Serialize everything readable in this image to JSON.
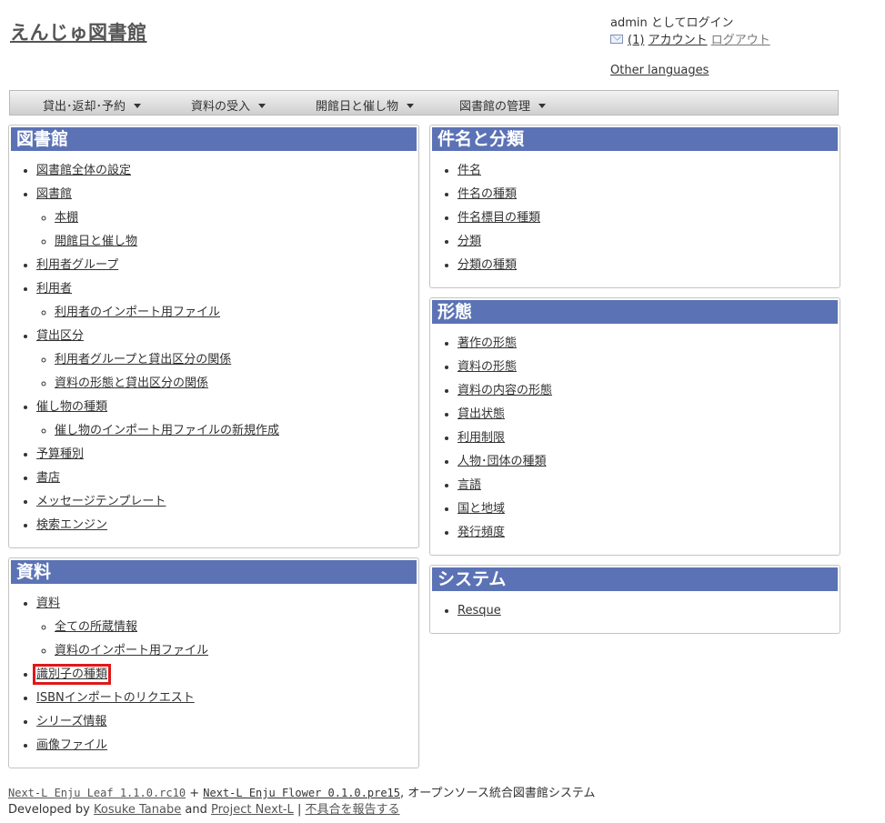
{
  "site": {
    "title": "えんじゅ図書館"
  },
  "user": {
    "login_text": "admin としてログイン",
    "message_count": "(1)",
    "account": "アカウント",
    "logout": "ログアウト",
    "other_languages": "Other languages",
    "mail_icon": "mail-icon"
  },
  "nav": [
    {
      "label": "貸出･返却･予約"
    },
    {
      "label": "資料の受入"
    },
    {
      "label": "開館日と催し物"
    },
    {
      "label": "図書館の管理"
    }
  ],
  "panels": {
    "library": {
      "title": "図書館",
      "items": [
        {
          "label": "図書館全体の設定"
        },
        {
          "label": "図書館",
          "children": [
            {
              "label": "本棚"
            },
            {
              "label": "開館日と催し物"
            }
          ]
        },
        {
          "label": "利用者グループ"
        },
        {
          "label": "利用者",
          "children": [
            {
              "label": "利用者のインポート用ファイル"
            }
          ]
        },
        {
          "label": "貸出区分",
          "children": [
            {
              "label": "利用者グループと貸出区分の関係"
            },
            {
              "label": "資料の形態と貸出区分の関係"
            }
          ]
        },
        {
          "label": "催し物の種類",
          "children": [
            {
              "label": "催し物のインポート用ファイルの新規作成"
            }
          ]
        },
        {
          "label": "予算種別"
        },
        {
          "label": "書店"
        },
        {
          "label": "メッセージテンプレート"
        },
        {
          "label": "検索エンジン"
        }
      ]
    },
    "materials": {
      "title": "資料",
      "items": [
        {
          "label": "資料",
          "children": [
            {
              "label": "全ての所蔵情報"
            },
            {
              "label": "資料のインポート用ファイル"
            }
          ]
        },
        {
          "label": "識別子の種類",
          "highlighted": true
        },
        {
          "label": "ISBNインポートのリクエスト"
        },
        {
          "label": "シリーズ情報"
        },
        {
          "label": "画像ファイル"
        }
      ]
    },
    "subjects": {
      "title": "件名と分類",
      "items": [
        {
          "label": "件名"
        },
        {
          "label": "件名の種類"
        },
        {
          "label": "件名標目の種類"
        },
        {
          "label": "分類"
        },
        {
          "label": "分類の種類"
        }
      ]
    },
    "forms": {
      "title": "形態",
      "items": [
        {
          "label": "著作の形態"
        },
        {
          "label": "資料の形態"
        },
        {
          "label": "資料の内容の形態"
        },
        {
          "label": "貸出状態"
        },
        {
          "label": "利用制限"
        },
        {
          "label": "人物･団体の種類"
        },
        {
          "label": "言語"
        },
        {
          "label": "国と地域"
        },
        {
          "label": "発行頻度"
        }
      ]
    },
    "system": {
      "title": "システム",
      "items": [
        {
          "label": "Resque"
        }
      ]
    }
  },
  "footer": {
    "leaf": "Next-L Enju Leaf 1.1.0.rc10",
    "plus": " + ",
    "flower": "Next-L Enju Flower 0.1.0.pre15",
    "desc": ", オープンソース統合図書館システム",
    "developed_by": "Developed by ",
    "author": "Kosuke Tanabe",
    "and": " and ",
    "project": "Project Next-L",
    "sep": " | ",
    "report": "不具合を報告する"
  },
  "colors": {
    "panel_header": "#5b72b5",
    "highlight": "#e01818"
  }
}
